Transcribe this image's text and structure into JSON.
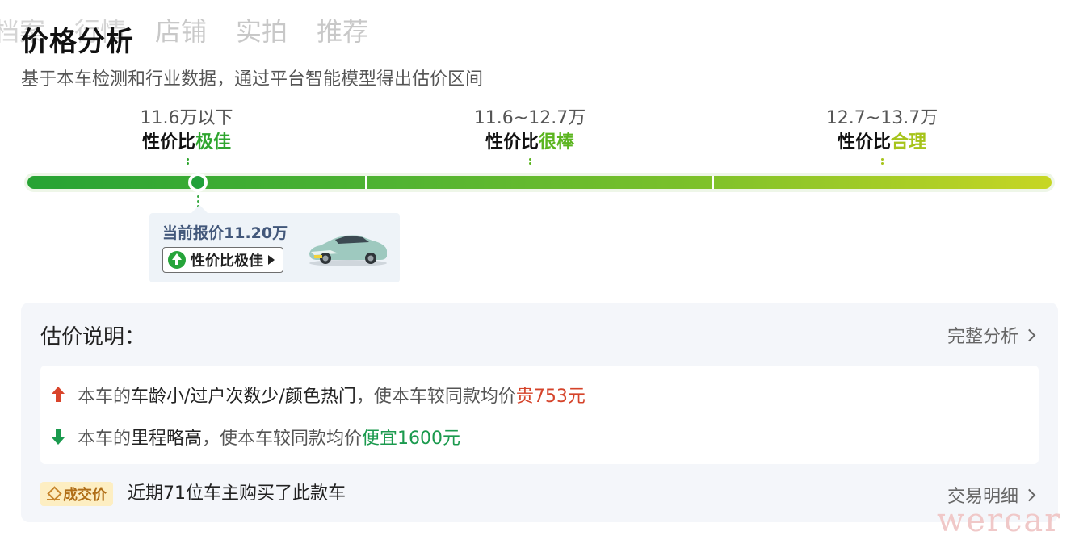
{
  "bg_tabs": [
    "档案",
    "行情",
    "店铺",
    "实拍",
    "推荐"
  ],
  "header": {
    "title": "价格分析",
    "subtitle": "基于本车检测和行业数据，通过平台智能模型得出估价区间"
  },
  "tiers": [
    {
      "range": "11.6万以下",
      "prefix": "性价比",
      "grade": "极佳"
    },
    {
      "range": "11.6~12.7万",
      "prefix": "性价比",
      "grade": "很棒"
    },
    {
      "range": "12.7~13.7万",
      "prefix": "性价比",
      "grade": "合理"
    }
  ],
  "quote": {
    "label": "当前报价11.20万",
    "badge": "性价比极佳",
    "badge_icon": "up-circle-icon",
    "car_image": "car-thumbnail"
  },
  "panel": {
    "title": "估价说明：",
    "full_analysis": "完整分析",
    "reasons": [
      {
        "prefix": "本车的",
        "factor": "车龄小/过户次数少/颜色热门",
        "middle": "，使本车较同款均价",
        "effect": "贵753元",
        "direction": "up"
      },
      {
        "prefix": "本车的",
        "factor": "里程略高",
        "middle": "，使本车较同款均价",
        "effect": "便宜1600元",
        "direction": "down"
      }
    ],
    "deal_badge": "成交价",
    "deal_text": "近期71位车主购买了此款车",
    "deal_detail": "交易明细"
  },
  "watermark": "wercar",
  "colors": {
    "excellent": "#2ea52e",
    "great": "#5bb51f",
    "fair": "#a6c41a",
    "price_up": "#d5432a",
    "price_down": "#1b9a4e"
  }
}
